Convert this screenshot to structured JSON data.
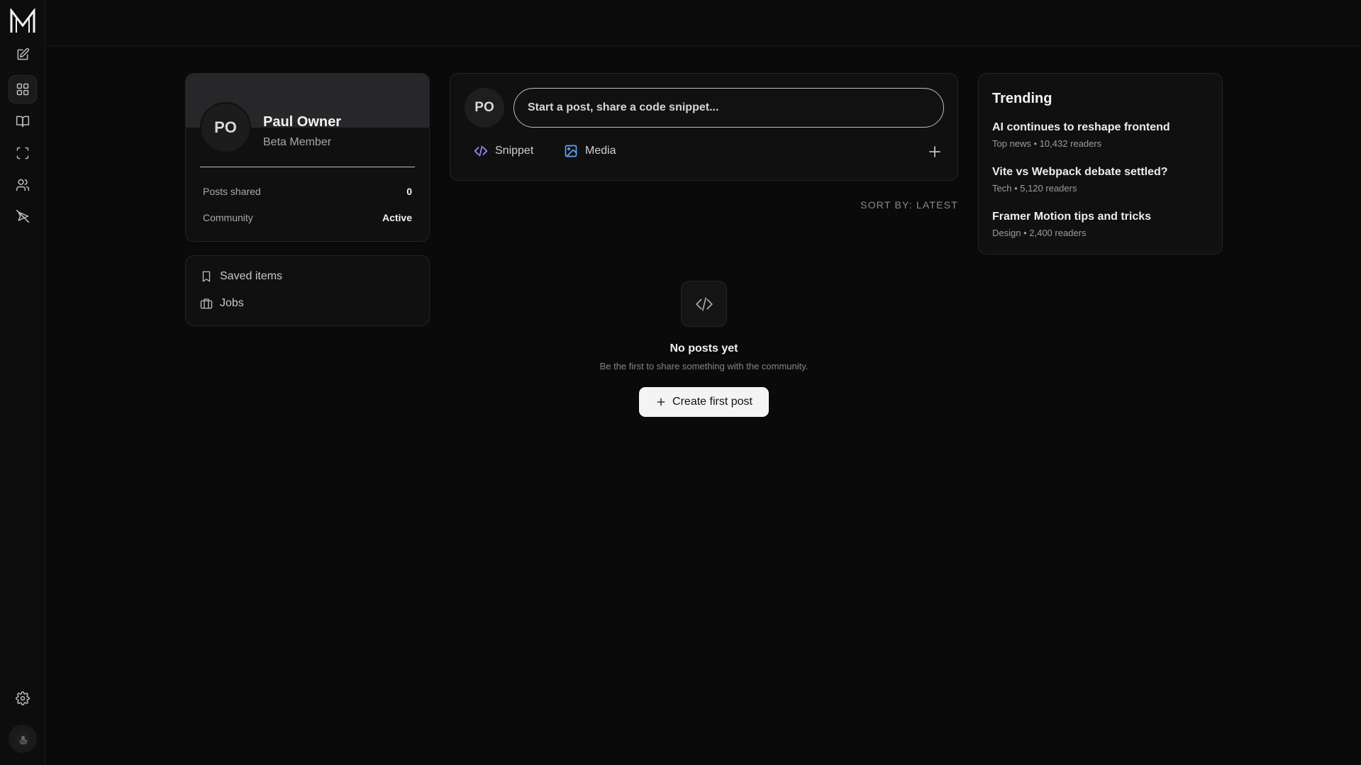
{
  "sidebar": {
    "logo_icon": "m-logo-icon",
    "items": [
      {
        "icon": "compose-icon",
        "active": false
      },
      {
        "icon": "grid-icon",
        "active": true
      },
      {
        "icon": "book-icon",
        "active": false
      },
      {
        "icon": "scan-icon",
        "active": false
      },
      {
        "icon": "users-icon",
        "active": false
      },
      {
        "icon": "send-off-icon",
        "active": false
      }
    ],
    "settings_icon": "gear-icon",
    "user_avatar_icon": "user-avatar"
  },
  "profile": {
    "initials": "PO",
    "name": "Paul Owner",
    "role": "Beta Member",
    "stats": [
      {
        "label": "Posts shared",
        "value": "0"
      },
      {
        "label": "Community",
        "value": "Active"
      }
    ]
  },
  "quick_links": {
    "saved": "Saved items",
    "jobs": "Jobs"
  },
  "composer": {
    "initials": "PO",
    "placeholder": "Start a post, share a code snippet...",
    "snippet_label": "Snippet",
    "media_label": "Media",
    "snippet_color": "#a78bfa",
    "media_color": "#60a5fa"
  },
  "feed": {
    "sort_label": "SORT BY: LATEST",
    "empty_title": "No posts yet",
    "empty_subtitle": "Be the first to share something with the community.",
    "create_label": "Create first post"
  },
  "trending": {
    "heading": "Trending",
    "items": [
      {
        "title": "AI continues to reshape frontend",
        "meta": "Top news • 10,432 readers"
      },
      {
        "title": "Vite vs Webpack debate settled?",
        "meta": "Tech • 5,120 readers"
      },
      {
        "title": "Framer Motion tips and tricks",
        "meta": "Design • 2,400 readers"
      }
    ]
  }
}
